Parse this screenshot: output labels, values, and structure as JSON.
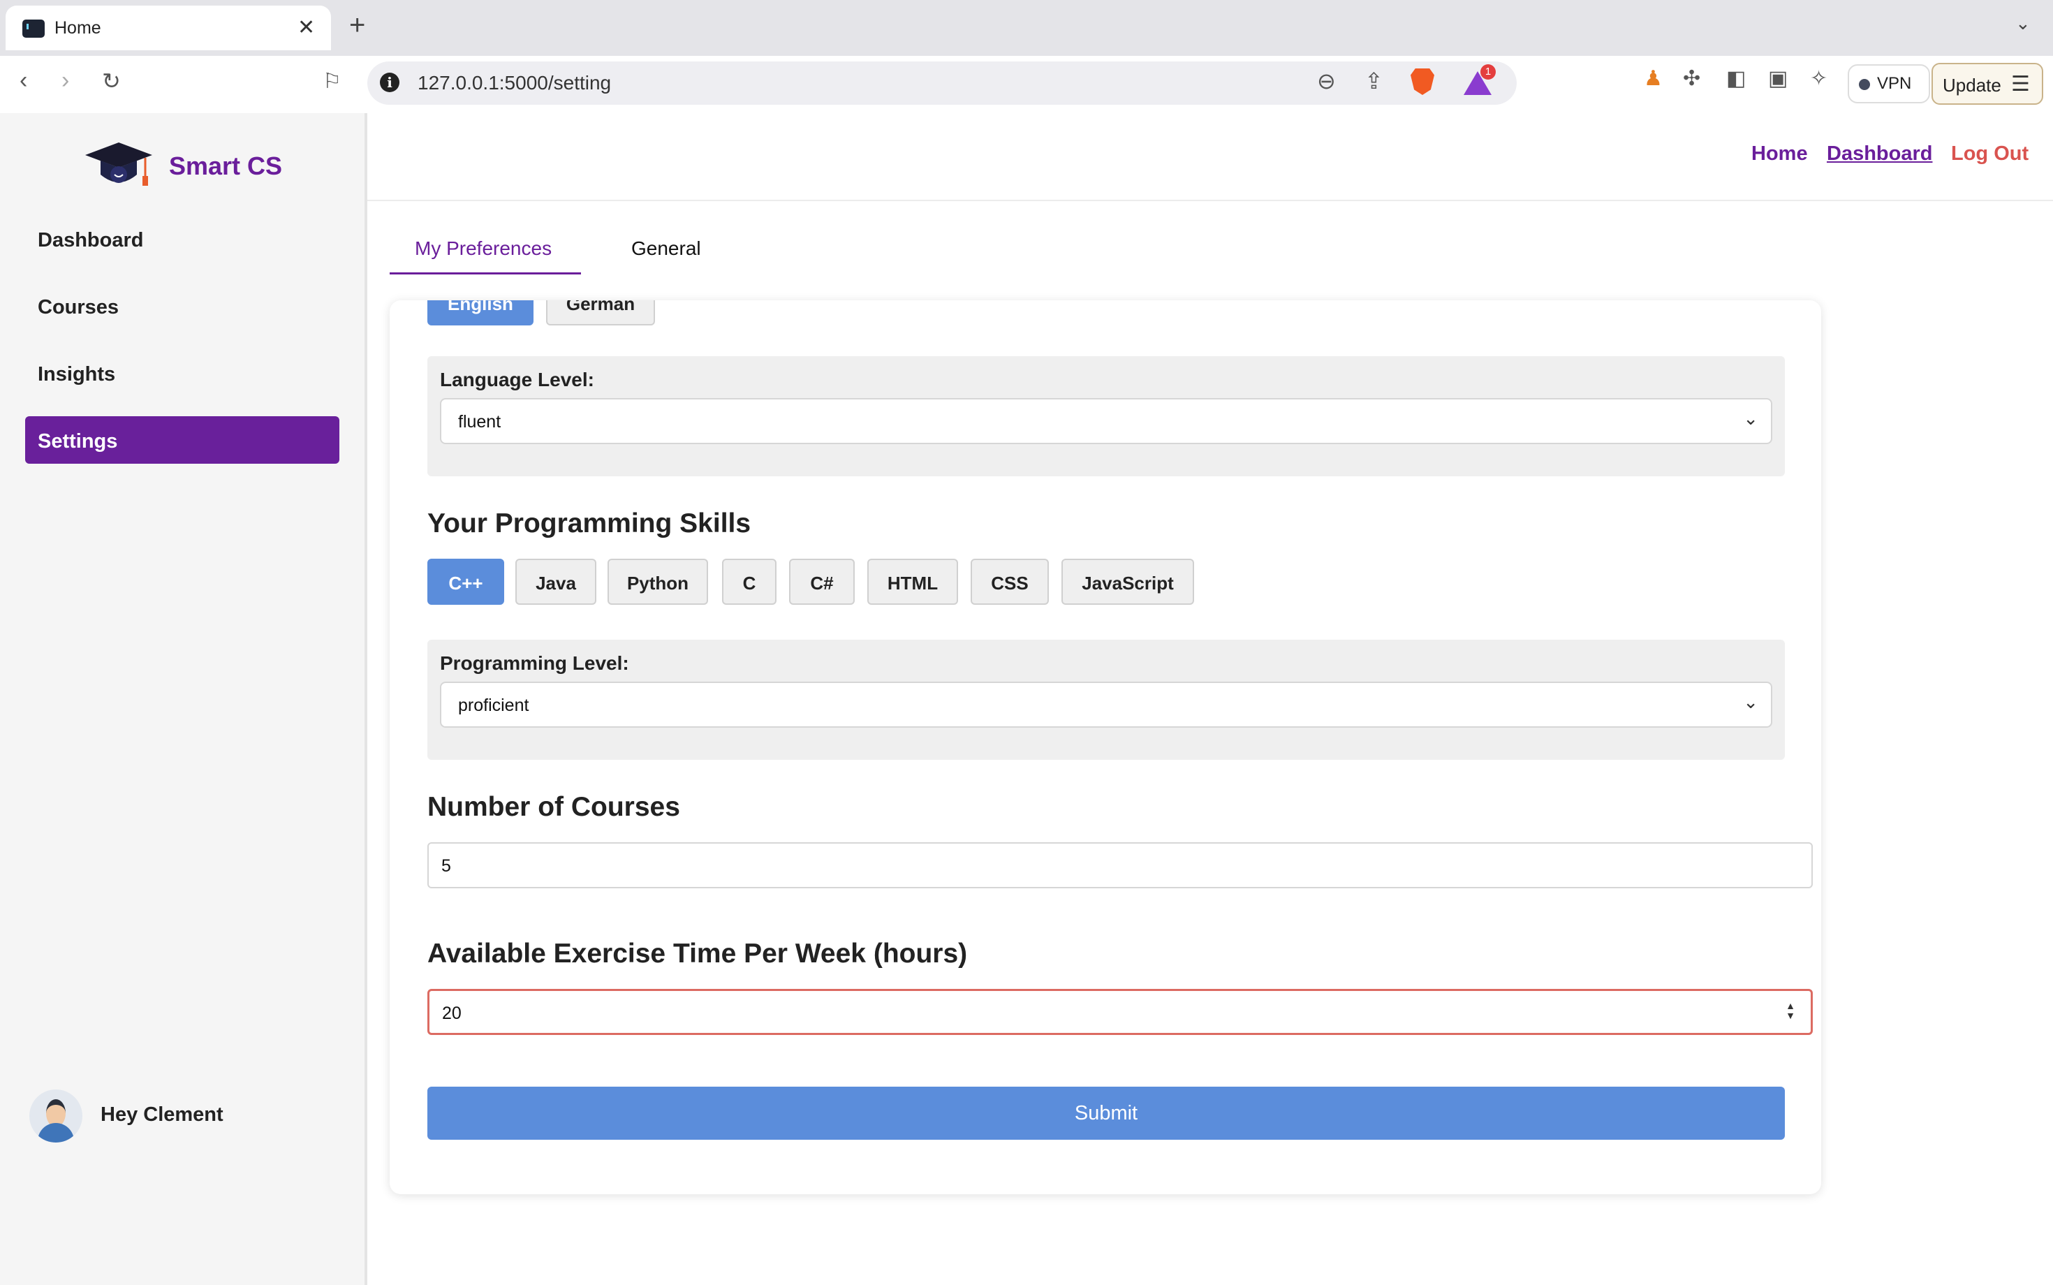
{
  "browser": {
    "tab_title": "Home",
    "url": "127.0.0.1:5000/setting",
    "rewards_badge": "1",
    "vpn_label": "VPN",
    "update_label": "Update"
  },
  "app": {
    "brand": "Smart CS",
    "nav": [
      {
        "label": "Dashboard"
      },
      {
        "label": "Courses"
      },
      {
        "label": "Insights"
      },
      {
        "label": "Settings"
      }
    ],
    "greeting": "Hey Clement"
  },
  "topnav": {
    "home": "Home",
    "dashboard": "Dashboard",
    "logout": "Log Out"
  },
  "tabs": {
    "preferences": "My Preferences",
    "general": "General"
  },
  "form": {
    "languages": [
      "English",
      "German"
    ],
    "selected_language": "English",
    "language_level_label": "Language Level:",
    "language_level_value": "fluent",
    "programming_heading": "Your Programming Skills",
    "skills": [
      "C++",
      "Java",
      "Python",
      "C",
      "C#",
      "HTML",
      "CSS",
      "JavaScript"
    ],
    "selected_skill": "C++",
    "programming_level_label": "Programming Level:",
    "programming_level_value": "proficient",
    "courses_heading": "Number of Courses",
    "courses_value": "5",
    "exercise_heading": "Available Exercise Time Per Week (hours)",
    "exercise_value": "20",
    "submit_label": "Submit"
  },
  "colors": {
    "brand_purple": "#6a1e9b",
    "accent_blue": "#5b8ddb",
    "logout_red": "#d9534f",
    "focus_border": "#dc6b62"
  }
}
